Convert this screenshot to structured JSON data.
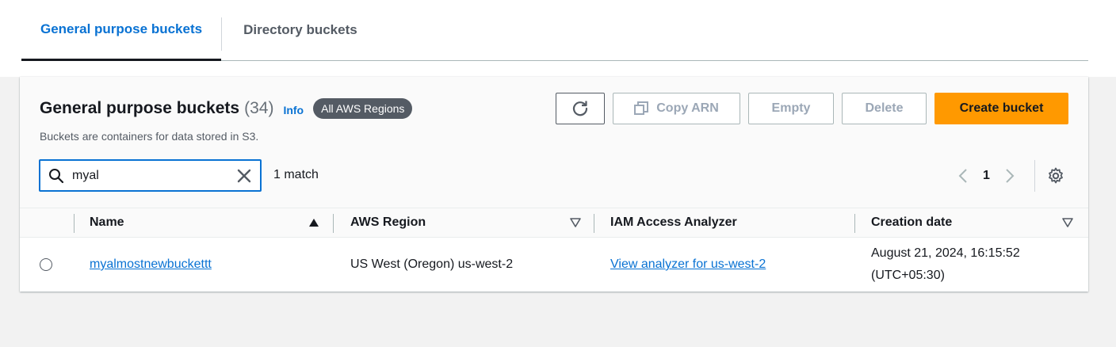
{
  "tabs": [
    {
      "label": "General purpose buckets",
      "active": true
    },
    {
      "label": "Directory buckets",
      "active": false
    }
  ],
  "header": {
    "title": "General purpose buckets",
    "count": "(34)",
    "info": "Info",
    "region_badge": "All AWS Regions",
    "description": "Buckets are containers for data stored in S3."
  },
  "toolbar": {
    "refresh_icon": "refresh-icon",
    "copy_arn_label": "Copy ARN",
    "empty_label": "Empty",
    "delete_label": "Delete",
    "create_label": "Create bucket"
  },
  "search": {
    "value": "myal",
    "match_text": "1 match"
  },
  "pagination": {
    "current_page": "1"
  },
  "table": {
    "columns": [
      "Name",
      "AWS Region",
      "IAM Access Analyzer",
      "Creation date"
    ],
    "rows": [
      {
        "name": "myalmostnewbuckettt",
        "region": "US West (Oregon) us-west-2",
        "analyzer": "View analyzer for us-west-2",
        "date_line1": "August 21, 2024, 16:15:52",
        "date_line2": "(UTC+05:30)"
      }
    ]
  },
  "colors": {
    "accent": "#0972d3",
    "primary_button": "#ff9900",
    "badge": "#545b64"
  }
}
